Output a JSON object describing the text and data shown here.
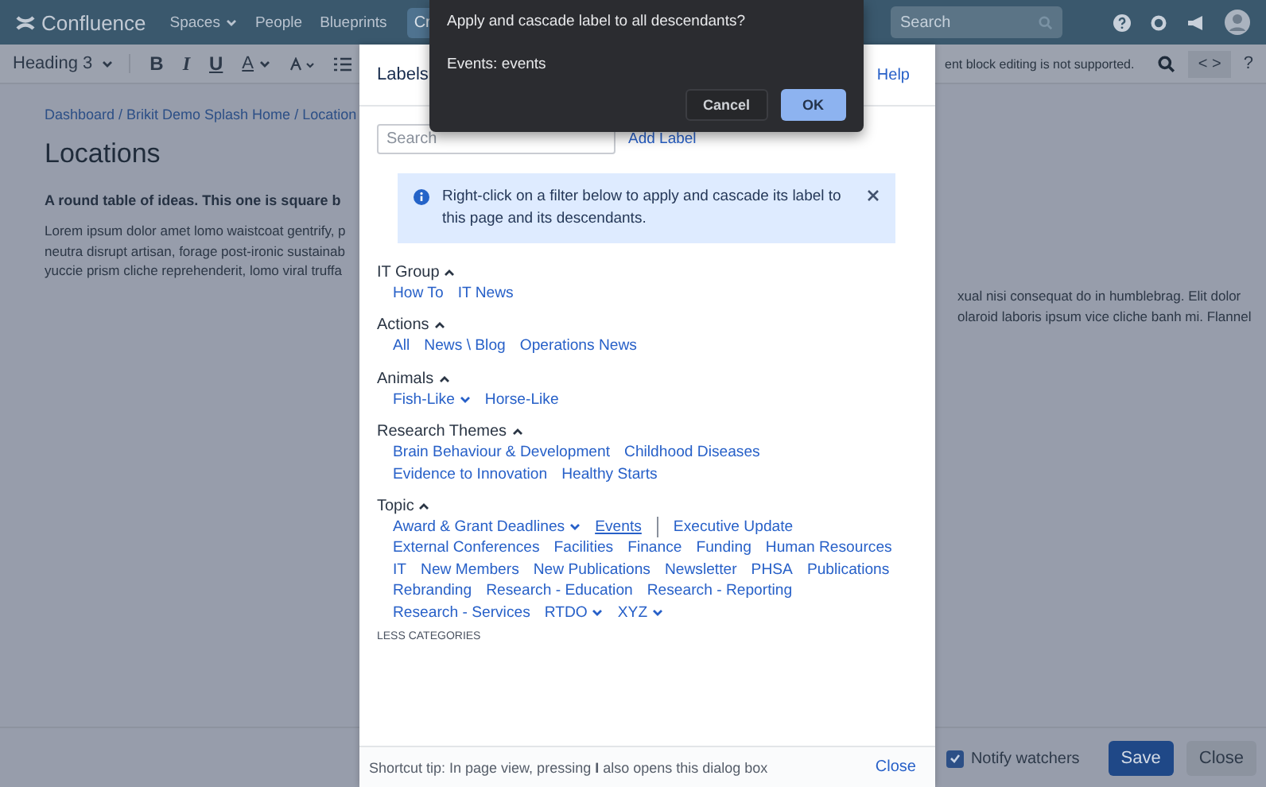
{
  "top_nav": {
    "logo": "Confluence",
    "items": [
      {
        "label": "Spaces",
        "dropdown": true
      },
      {
        "label": "People",
        "dropdown": false
      },
      {
        "label": "Blueprints",
        "dropdown": false
      }
    ],
    "create_button": "Cr",
    "search": {
      "placeholder": "Search"
    }
  },
  "editor_toolbar": {
    "style_select": "Heading 3",
    "format_buttons": [
      "B",
      "I",
      "U"
    ],
    "text_color": "A",
    "notice": "ent block editing is not supported.",
    "source_button": "< >",
    "help": "?"
  },
  "page": {
    "breadcrumbs": "Dashboard / Brikit Demo Splash Home / Location",
    "title": "Locations",
    "heading": "A round table of ideas. This one is square b",
    "body_left": [
      "Lorem ipsum dolor amet lomo waistcoat gentrify, p",
      "neutra disrupt artisan, forage post-ironic sustainab",
      "yuccie prism cliche reprehenderit, lomo viral truffa"
    ],
    "body_right": [
      "xual nisi consequat do in humblebrag. Elit dolor",
      "olaroid laboris ipsum vice cliche banh mi. Flannel"
    ]
  },
  "bottom_bar": {
    "notify_watchers": {
      "label": "Notify watchers",
      "checked": true
    },
    "save": "Save",
    "close": "Close"
  },
  "labels_dialog": {
    "title": "Labels",
    "help": "Help",
    "search": {
      "placeholder": "Search"
    },
    "add_label": "Add Label",
    "info": "Right-click on a filter below to apply and cascade its label to this page and its descendants.",
    "categories": [
      {
        "name": "IT Group",
        "expanded": true,
        "labels": [
          {
            "text": "How To",
            "dropdown": false,
            "selected": false
          },
          {
            "text": "IT News",
            "dropdown": false,
            "selected": false
          }
        ]
      },
      {
        "name": "Actions",
        "expanded": true,
        "labels": [
          {
            "text": "All",
            "dropdown": false,
            "selected": false
          },
          {
            "text": "News \\ Blog",
            "dropdown": false,
            "selected": false
          },
          {
            "text": "Operations News",
            "dropdown": false,
            "selected": false
          }
        ]
      },
      {
        "name": "Animals",
        "expanded": true,
        "labels": [
          {
            "text": "Fish-Like",
            "dropdown": true,
            "selected": false
          },
          {
            "text": "Horse-Like",
            "dropdown": false,
            "selected": false
          }
        ]
      },
      {
        "name": "Research Themes",
        "expanded": true,
        "labels": [
          {
            "text": "Brain Behaviour & Development",
            "dropdown": false,
            "selected": false
          },
          {
            "text": "Childhood Diseases",
            "dropdown": false,
            "selected": false
          },
          {
            "text": "Evidence to Innovation",
            "dropdown": false,
            "selected": false
          },
          {
            "text": "Healthy Starts",
            "dropdown": false,
            "selected": false
          }
        ]
      },
      {
        "name": "Topic",
        "expanded": true,
        "labels": [
          {
            "text": "Award & Grant Deadlines",
            "dropdown": true,
            "selected": false
          },
          {
            "text": "Events",
            "dropdown": false,
            "selected": true
          },
          {
            "text": "Executive Update",
            "dropdown": false,
            "selected": false
          },
          {
            "text": "External Conferences",
            "dropdown": false,
            "selected": false
          },
          {
            "text": "Facilities",
            "dropdown": false,
            "selected": false
          },
          {
            "text": "Finance",
            "dropdown": false,
            "selected": false
          },
          {
            "text": "Funding",
            "dropdown": false,
            "selected": false
          },
          {
            "text": "Human Resources",
            "dropdown": false,
            "selected": false
          },
          {
            "text": "IT",
            "dropdown": false,
            "selected": false
          },
          {
            "text": "New Members",
            "dropdown": false,
            "selected": false
          },
          {
            "text": "New Publications",
            "dropdown": false,
            "selected": false
          },
          {
            "text": "Newsletter",
            "dropdown": false,
            "selected": false
          },
          {
            "text": "PHSA",
            "dropdown": false,
            "selected": false
          },
          {
            "text": "Publications",
            "dropdown": false,
            "selected": false
          },
          {
            "text": "Rebranding",
            "dropdown": false,
            "selected": false
          },
          {
            "text": "Research - Education",
            "dropdown": false,
            "selected": false
          },
          {
            "text": "Research - Reporting",
            "dropdown": false,
            "selected": false
          },
          {
            "text": "Research - Services",
            "dropdown": false,
            "selected": false
          },
          {
            "text": "RTDO",
            "dropdown": true,
            "selected": false
          },
          {
            "text": "XYZ",
            "dropdown": true,
            "selected": false
          }
        ]
      }
    ],
    "less_categories": "LESS CATEGORIES",
    "footer_tip": "Shortcut tip: In page view, pressing **I** also opens this dialog box",
    "close": "Close"
  },
  "confirm_popup": {
    "title": "Apply and cascade label to all descendants?",
    "message": "Events: events",
    "cancel": "Cancel",
    "ok": "OK"
  }
}
